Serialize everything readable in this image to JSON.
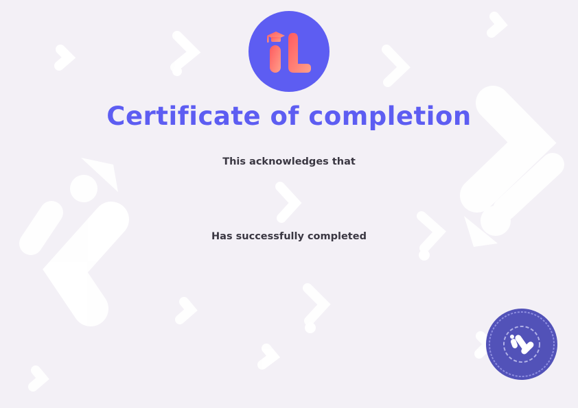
{
  "certificate": {
    "title": "Certificate of completion",
    "acknowledgement": "This acknowledges that",
    "completion_text": "Has successfully completed"
  },
  "branding": {
    "logo_text": "iL",
    "logo_icon": "graduation-cap-icon",
    "seal_icon": "brand-seal-icon"
  },
  "colors": {
    "background": "#f3f0f6",
    "accent": "#5d5df2",
    "logo_gradient_start": "#ff5a5f",
    "logo_gradient_end": "#ffa08a",
    "text": "#3a3742",
    "watermark": "#ffffff"
  }
}
